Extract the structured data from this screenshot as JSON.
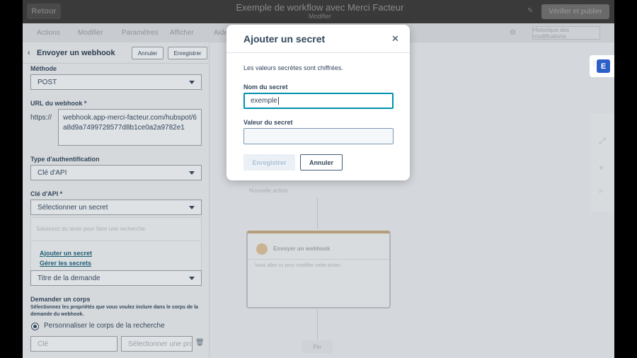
{
  "topbar": {
    "back_label": "Retour",
    "workflow_title": "Exemple de workflow avec Merci Facteur",
    "workflow_sub": "Modifier",
    "review_button": "Vérifier et publier"
  },
  "tabs": {
    "items": [
      "Actions",
      "Modifier",
      "Paramètres",
      "Afficher",
      "Aide"
    ],
    "right_button": "Historique des modifications"
  },
  "panel": {
    "title": "Envoyer un webhook",
    "cancel_label": "Annuler",
    "save_label": "Enregistrer",
    "method_label": "Méthode",
    "method_value": "POST",
    "url_label": "URL du webhook *",
    "url_prefix": "https://",
    "url_value": "webhook.app-merci-facteur.com/hubspot/6a8d9a7499728577d8b1ce0a2a9782e1",
    "auth_label": "Type d'authentification",
    "auth_value": "Clé d'API",
    "api_key_label": "Clé d'API *",
    "api_key_value": "Sélectionner un secret",
    "search_placeholder": "Saisissez du texte pour faire une recherche",
    "add_secret_link": "Ajouter un secret",
    "manage_secrets_link": "Gérer les secrets",
    "header_value": "Titre de la demande",
    "body_label": "Demander un corps",
    "body_desc": "Sélectionnez les propriétés que vous voulez inclure dans le corps de la demande du webhook.",
    "radio_label": "Personnaliser le corps de la recherche",
    "key_placeholder": "Clé",
    "property_placeholder": "Sélectionner une propriété"
  },
  "canvas": {
    "card_title": "Envoyer un webhook",
    "card_text": "Vous allez ici pour modifier cette action",
    "row_text": "Nouvelle action",
    "end_label": "Fin"
  },
  "modal": {
    "title": "Ajouter un secret",
    "note": "Les valeurs secrètes sont chiffrées.",
    "name_label": "Nom du secret",
    "name_value": "exemple",
    "value_label": "Valeur du secret",
    "value_value": "",
    "save_label": "Enregistrer",
    "cancel_label": "Annuler"
  },
  "widget": {
    "icon_letter": "E",
    "accent": "#2d5fc8"
  }
}
